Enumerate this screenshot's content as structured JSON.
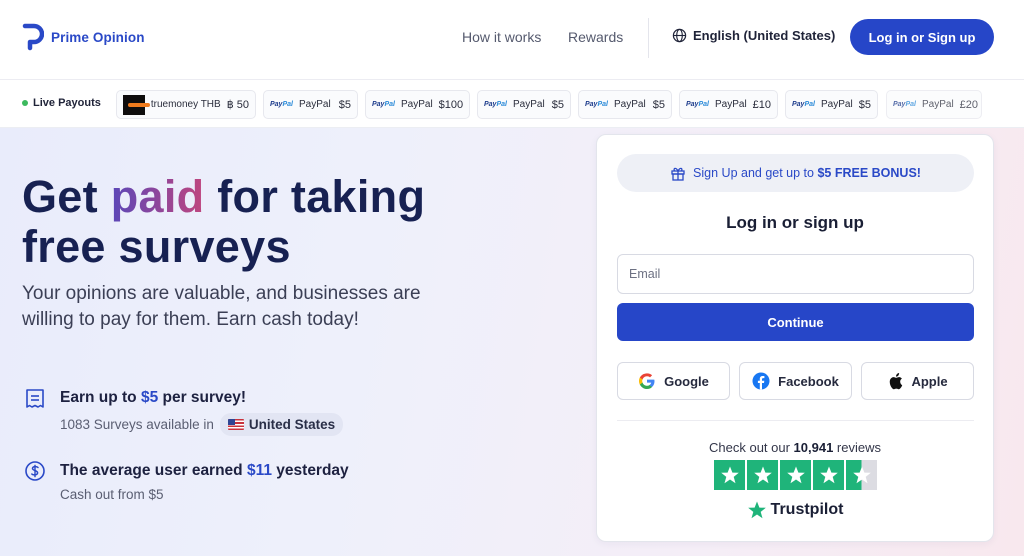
{
  "header": {
    "brand": "Prime Opinion",
    "nav": [
      {
        "label": "How it works"
      },
      {
        "label": "Rewards"
      }
    ],
    "language": "English (United States)",
    "login_label": "Log in or Sign up"
  },
  "payouts": {
    "label": "Live Payouts",
    "items": [
      {
        "method": "truemoney THB",
        "amount": "฿ 50",
        "logo": "truemoney-logo"
      },
      {
        "method": "PayPal",
        "amount": "$5",
        "logo": "paypal-logo"
      },
      {
        "method": "PayPal",
        "amount": "$100",
        "logo": "paypal-logo"
      },
      {
        "method": "PayPal",
        "amount": "$5",
        "logo": "paypal-logo"
      },
      {
        "method": "PayPal",
        "amount": "$5",
        "logo": "paypal-logo"
      },
      {
        "method": "PayPal",
        "amount": "£10",
        "logo": "paypal-logo"
      },
      {
        "method": "PayPal",
        "amount": "$5",
        "logo": "paypal-logo"
      },
      {
        "method": "PayPal",
        "amount": "£20",
        "logo": "paypal-logo"
      }
    ]
  },
  "hero": {
    "headline_part1": "Get ",
    "headline_accent": "paid",
    "headline_part2": " for taking",
    "headline_line2": "free surveys",
    "subheadline": "Your opinions are valuable, and businesses are willing to pay for them. Earn cash today!",
    "feature1": {
      "title_pre": "Earn up to ",
      "title_value": "$5",
      "title_post": " per survey!",
      "sub": "1083 Surveys available in",
      "country": "United States"
    },
    "feature2": {
      "title_pre": "The average user earned ",
      "title_value": "$11",
      "title_post": " yesterday",
      "sub": "Cash out from $5"
    }
  },
  "login_card": {
    "bonus_pre": "Sign Up and get up to ",
    "bonus_bold": "$5 FREE BONUS!",
    "title": "Log in or sign up",
    "email_placeholder": "Email",
    "continue_label": "Continue",
    "social": [
      {
        "label": "Google"
      },
      {
        "label": "Facebook"
      },
      {
        "label": "Apple"
      }
    ],
    "reviews_pre": "Check out our ",
    "reviews_count": "10,941",
    "reviews_post": " reviews",
    "rating_stars": 4.5,
    "trustpilot_label": "Trustpilot"
  },
  "colors": {
    "primary": "#2646c8",
    "trustpilot_green": "#1fb47a",
    "live_dot": "#3cb95e"
  }
}
